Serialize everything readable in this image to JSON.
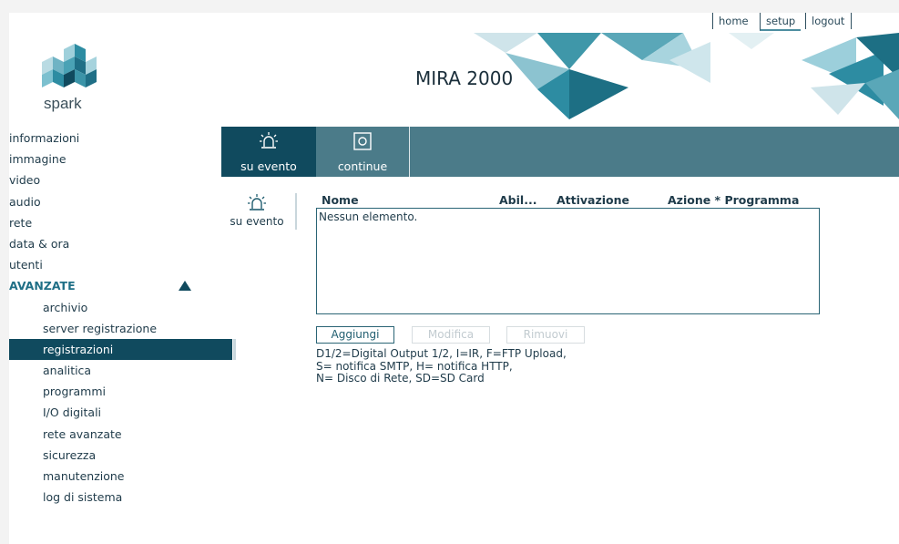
{
  "topnav": {
    "home": "home",
    "setup": "setup",
    "logout": "logout"
  },
  "header": {
    "logo_text": "spark",
    "title": "MIRA 2000"
  },
  "sidebar": {
    "items": [
      "informazioni",
      "immagine",
      "video",
      "audio",
      "rete",
      "data & ora",
      "utenti"
    ],
    "section": "AVANZATE",
    "sub_items": [
      "archivio",
      "server registrazione",
      "registrazioni",
      "analitica",
      "programmi",
      "I/O digitali",
      "rete avanzate",
      "sicurezza",
      "manutenzione",
      "log di sistema"
    ],
    "active": "registrazioni"
  },
  "tabs": {
    "event": "su evento",
    "continuous": "continue"
  },
  "subtab": {
    "label": "su evento"
  },
  "table": {
    "columns": [
      "Nome",
      "Abil...",
      "Attivazione",
      "Azione * Programma"
    ],
    "empty": "Nessun elemento."
  },
  "buttons": {
    "add": "Aggiungi",
    "edit": "Modifica",
    "remove": "Rimuovi"
  },
  "legend": [
    "D1/2=Digital Output 1/2, I=IR, F=FTP Upload,",
    "S= notifica SMTP, H= notifica HTTP,",
    "N= Disco di Rete, SD=SD Card"
  ],
  "colors": {
    "primary": "#104a5e",
    "tabbar": "#4b7b89",
    "accent": "#1f6f86"
  }
}
